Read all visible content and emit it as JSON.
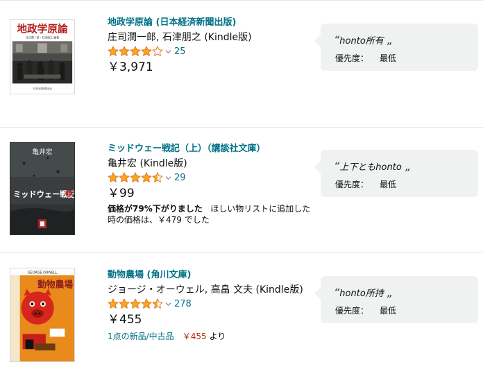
{
  "items": [
    {
      "title": "地政学原論 (日本経済新聞出版)",
      "author": "庄司潤一郎, 石津朋之 (Kindle版)",
      "stars": 4.0,
      "rating_count": "25",
      "price": "￥3,971",
      "comment": "honto所有",
      "priority_label": "優先度：",
      "priority_value": "最低",
      "cover": {
        "title_text": "地政学原論",
        "subtitle_text": "庄司潤一郎・石津朋之 編著",
        "publisher_text": "日本経済新聞出版"
      }
    },
    {
      "title": "ミッドウェー戦記（上）（講談社文庫）",
      "author": "亀井宏 (Kindle版)",
      "stars": 4.5,
      "rating_count": "29",
      "price": "￥99",
      "drop_bold": "価格が79%下がりました",
      "drop_rest": "ほしい物リストに追加した時の価格は、￥479 でした",
      "comment": "上下ともhonto",
      "priority_label": "優先度：",
      "priority_value": "最低",
      "cover": {
        "author_text": "亀井宏",
        "title_text": "ミッドウェー戦記",
        "vol_text": "上"
      }
    },
    {
      "title": "動物農場 (角川文庫)",
      "author": "ジョージ・オーウェル, 高畠 文夫 (Kindle版)",
      "stars": 4.5,
      "rating_count": "278",
      "price": "￥455",
      "offers_link": "1点の新品/中古品",
      "offers_price": "￥455",
      "offers_suffix": "より",
      "comment": "honto所持",
      "priority_label": "優先度：",
      "priority_value": "最低",
      "cover": {
        "author_text": "GEORGE ORWELL",
        "title_text": "動物農場",
        "translator_text": "ジョージ・オーウェル"
      }
    }
  ],
  "colors": {
    "link": "#007185",
    "star": "#ffa41c",
    "price_red": "#b12704",
    "bubble": "#f0f2f2"
  }
}
